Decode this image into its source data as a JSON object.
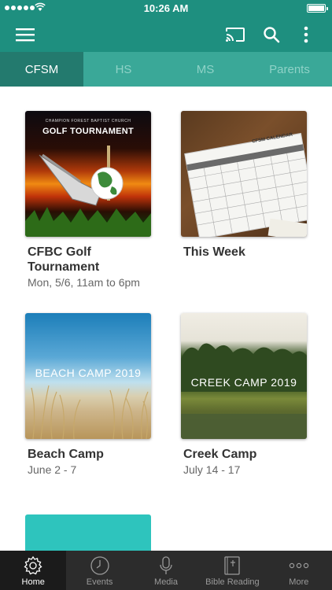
{
  "status_bar": {
    "time": "10:26 AM"
  },
  "app_bar": {
    "icons": [
      "menu-icon",
      "cast-icon",
      "search-icon",
      "more-vertical-icon"
    ],
    "accent_color": "#1e8f7f"
  },
  "tabs": [
    {
      "label": "CFSM",
      "active": true
    },
    {
      "label": "HS",
      "active": false
    },
    {
      "label": "MS",
      "active": false
    },
    {
      "label": "Parents",
      "active": false
    }
  ],
  "cards": [
    {
      "title": "CFBC Golf Tournament",
      "subtitle": "Mon, 5/6, 11am to 6pm",
      "image_text_top": "CHAMPION FOREST BAPTIST CHURCH",
      "image_text_title": "GOLF TOURNAMENT"
    },
    {
      "title": "This Week",
      "subtitle": "",
      "image_text_title": "CFSM CALENDAR"
    },
    {
      "title": "Beach Camp",
      "subtitle": "June 2 - 7",
      "image_text_title": "BEACH CAMP 2019"
    },
    {
      "title": "Creek Camp",
      "subtitle": "July 14 - 17",
      "image_text_title": "CREEK CAMP 2019"
    }
  ],
  "bottom_nav": [
    {
      "label": "Home",
      "icon": "gear-icon",
      "active": true
    },
    {
      "label": "Events",
      "icon": "clock-icon",
      "active": false
    },
    {
      "label": "Media",
      "icon": "microphone-icon",
      "active": false
    },
    {
      "label": "Bible Reading",
      "icon": "bible-icon",
      "active": false
    },
    {
      "label": "More",
      "icon": "more-horizontal-icon",
      "active": false
    }
  ]
}
